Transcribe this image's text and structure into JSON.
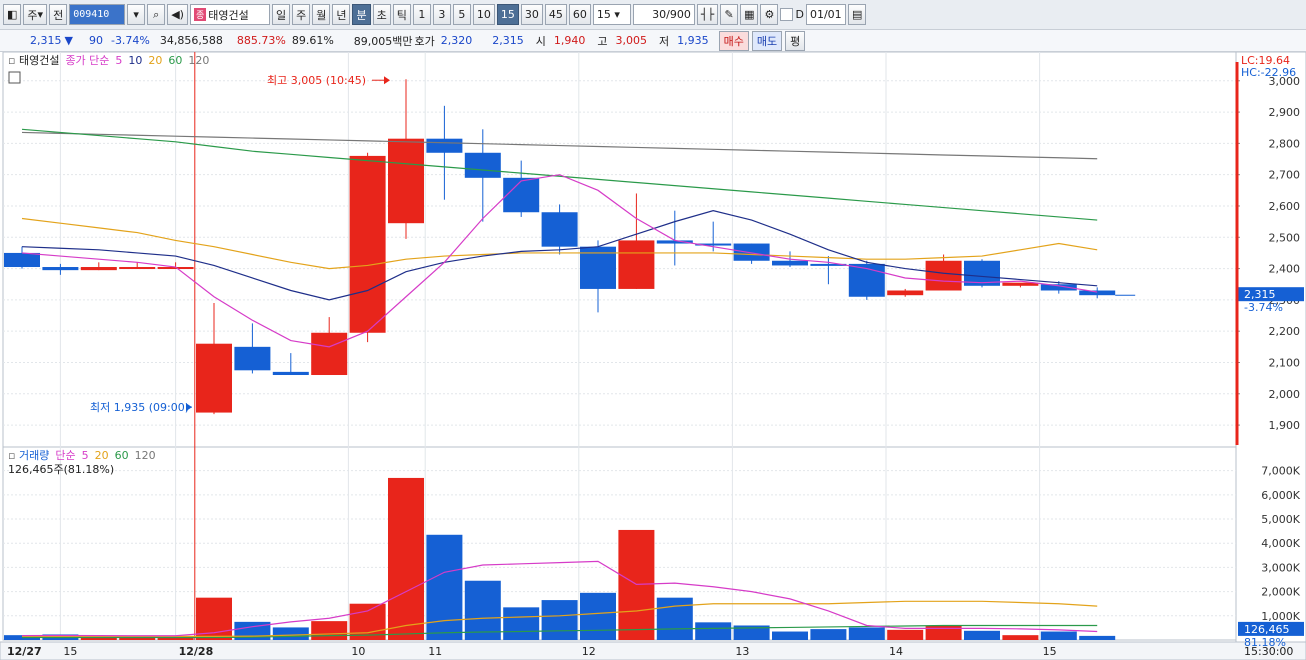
{
  "toolbar": {
    "type_label": "주",
    "prev_label": "전",
    "code": "009410",
    "stock_name": "태영건설",
    "stock_tag": "종",
    "periods": [
      "일",
      "주",
      "월",
      "년",
      "분",
      "초",
      "틱"
    ],
    "active_period": "분",
    "intervals": [
      "1",
      "3",
      "5",
      "10",
      "15",
      "30",
      "45",
      "60"
    ],
    "active_interval": "15",
    "interval_select": "15",
    "count_value": "30",
    "count_max": "/900",
    "date_value": "01/01",
    "checkbox_label": "D"
  },
  "quote": {
    "price": "2,315",
    "arrow": "▼",
    "change": "90",
    "change_pct": "-3.74%",
    "volume": "34,856,588",
    "volume_ratio": "885.73%",
    "turnover_ratio": "89.61%",
    "amount": "89,005백만",
    "ask_label": "호가",
    "ask": "2,320",
    "bid": "2,315",
    "open_label": "시",
    "open": "1,940",
    "high_label": "고",
    "high": "3,005",
    "low_label": "저",
    "low": "1,935",
    "buy_label": "매수",
    "sell_label": "매도",
    "avg_label": "평"
  },
  "colors": {
    "up": "#e8251b",
    "down": "#1560d4",
    "ma5": "#d63cc8",
    "ma10": "#1f2f8a",
    "ma20": "#e3a31b",
    "ma60": "#2b9a4a",
    "ma120": "#777777"
  },
  "chart_data": [
    {
      "type": "candlestick",
      "title": "태영건설",
      "legend_label": "종가 단순",
      "ma_labels": [
        "5",
        "10",
        "20",
        "60",
        "120"
      ],
      "info_lc": "LC:19.64",
      "info_hc": "HC:-22.96",
      "annotation_high": "최고 3,005 (10:45)",
      "annotation_low": "최저 1,935 (09:00)",
      "last_price_label": "2,315",
      "last_change_label": "-3.74%",
      "ylim": [
        1830,
        3060
      ],
      "yticks": [
        "1,900",
        "2,000",
        "2,100",
        "2,200",
        "2,300",
        "2,400",
        "2,500",
        "2,600",
        "2,700",
        "2,800",
        "2,900",
        "3,000"
      ],
      "ytick_values": [
        1900,
        2000,
        2100,
        2200,
        2300,
        2400,
        2500,
        2600,
        2700,
        2800,
        2900,
        3000
      ],
      "candles": [
        {
          "o": 2450,
          "h": 2470,
          "c": 2405,
          "l": 2400
        },
        {
          "o": 2405,
          "h": 2415,
          "c": 2395,
          "l": 2380
        },
        {
          "o": 2395,
          "h": 2420,
          "c": 2405,
          "l": 2395
        },
        {
          "o": 2405,
          "h": 2420,
          "c": 2405,
          "l": 2400
        },
        {
          "o": 2405,
          "h": 2420,
          "c": 2405,
          "l": 2400
        },
        {
          "o": 1940,
          "h": 2290,
          "c": 2160,
          "l": 1935
        },
        {
          "o": 2150,
          "h": 2225,
          "c": 2075,
          "l": 2065
        },
        {
          "o": 2070,
          "h": 2130,
          "c": 2060,
          "l": 2060
        },
        {
          "o": 2060,
          "h": 2245,
          "c": 2195,
          "l": 2060
        },
        {
          "o": 2195,
          "h": 2770,
          "c": 2760,
          "l": 2165
        },
        {
          "o": 2545,
          "h": 3005,
          "c": 2815,
          "l": 2495
        },
        {
          "o": 2815,
          "h": 2920,
          "c": 2770,
          "l": 2620
        },
        {
          "o": 2770,
          "h": 2845,
          "c": 2690,
          "l": 2550
        },
        {
          "o": 2690,
          "h": 2745,
          "c": 2580,
          "l": 2565
        },
        {
          "o": 2580,
          "h": 2605,
          "c": 2470,
          "l": 2445
        },
        {
          "o": 2470,
          "h": 2490,
          "c": 2335,
          "l": 2260
        },
        {
          "o": 2335,
          "h": 2640,
          "c": 2490,
          "l": 2335
        },
        {
          "o": 2490,
          "h": 2585,
          "c": 2480,
          "l": 2410
        },
        {
          "o": 2480,
          "h": 2550,
          "c": 2475,
          "l": 2455
        },
        {
          "o": 2480,
          "h": 2480,
          "c": 2425,
          "l": 2415
        },
        {
          "o": 2425,
          "h": 2455,
          "c": 2410,
          "l": 2405
        },
        {
          "o": 2415,
          "h": 2440,
          "c": 2410,
          "l": 2350
        },
        {
          "o": 2415,
          "h": 2425,
          "c": 2310,
          "l": 2300
        },
        {
          "o": 2315,
          "h": 2335,
          "c": 2330,
          "l": 2310
        },
        {
          "o": 2330,
          "h": 2445,
          "c": 2425,
          "l": 2330
        },
        {
          "o": 2425,
          "h": 2430,
          "c": 2345,
          "l": 2340
        },
        {
          "o": 2345,
          "h": 2350,
          "c": 2355,
          "l": 2340
        },
        {
          "o": 2350,
          "h": 2360,
          "c": 2330,
          "l": 2320
        },
        {
          "o": 2330,
          "h": 2340,
          "c": 2315,
          "l": 2305
        }
      ],
      "ma5": [
        2450,
        2440,
        2430,
        2420,
        2405,
        2310,
        2235,
        2170,
        2150,
        2200,
        2310,
        2420,
        2560,
        2680,
        2700,
        2650,
        2560,
        2490,
        2470,
        2450,
        2430,
        2420,
        2400,
        2370,
        2360,
        2355,
        2360,
        2345,
        2325
      ],
      "ma10": [
        2470,
        2465,
        2460,
        2450,
        2440,
        2410,
        2370,
        2330,
        2300,
        2330,
        2390,
        2420,
        2440,
        2455,
        2460,
        2470,
        2510,
        2550,
        2585,
        2555,
        2510,
        2460,
        2420,
        2400,
        2385,
        2375,
        2365,
        2355,
        2345
      ],
      "ma20": [
        2560,
        2545,
        2530,
        2515,
        2490,
        2470,
        2445,
        2420,
        2400,
        2410,
        2430,
        2440,
        2445,
        2450,
        2450,
        2450,
        2450,
        2450,
        2450,
        2445,
        2440,
        2435,
        2430,
        2430,
        2435,
        2440,
        2460,
        2480,
        2460
      ],
      "ma60": [
        2845,
        2835,
        2825,
        2815,
        2805,
        2790,
        2775,
        2765,
        2755,
        2745,
        2735,
        2725,
        2715,
        2705,
        2695,
        2685,
        2675,
        2665,
        2655,
        2645,
        2635,
        2625,
        2615,
        2605,
        2595,
        2585,
        2575,
        2565,
        2555
      ],
      "ma120": [
        2835,
        2832,
        2829,
        2826,
        2823,
        2820,
        2817,
        2814,
        2811,
        2808,
        2805,
        2802,
        2799,
        2796,
        2793,
        2790,
        2787,
        2784,
        2781,
        2778,
        2775,
        2772,
        2769,
        2766,
        2763,
        2760,
        2757,
        2754,
        2751
      ]
    },
    {
      "type": "bar",
      "title": "거래량",
      "legend_label": "단순",
      "ma_labels": [
        "5",
        "20",
        "60",
        "120"
      ],
      "info": "126,465주(81.18%)",
      "last_value_label": "126,465",
      "last_pct_label": "81.18%",
      "ylim": [
        0,
        7400
      ],
      "yticks": [
        "1,000K",
        "2,000K",
        "3,000K",
        "4,000K",
        "5,000K",
        "6,000K",
        "7,000K"
      ],
      "ytick_values": [
        1000,
        2000,
        3000,
        4000,
        5000,
        6000,
        7000
      ],
      "values": [
        200,
        230,
        150,
        150,
        150,
        1750,
        750,
        520,
        780,
        1500,
        6700,
        4350,
        2450,
        1350,
        1650,
        1950,
        4550,
        1750,
        730,
        600,
        350,
        450,
        520,
        420,
        600,
        380,
        200,
        350,
        170
      ],
      "ma5": [
        180,
        185,
        180,
        175,
        175,
        300,
        550,
        750,
        900,
        1200,
        2000,
        2800,
        3100,
        3150,
        3200,
        3250,
        2300,
        2350,
        2200,
        2000,
        1700,
        1200,
        600,
        480,
        480,
        480,
        460,
        420,
        350
      ],
      "ma20": [
        150,
        150,
        150,
        150,
        150,
        150,
        160,
        200,
        250,
        300,
        600,
        800,
        900,
        950,
        1000,
        1100,
        1200,
        1400,
        1500,
        1500,
        1500,
        1500,
        1550,
        1600,
        1600,
        1600,
        1550,
        1500,
        1400
      ],
      "ma60": [
        100,
        100,
        100,
        100,
        100,
        100,
        120,
        150,
        180,
        200,
        250,
        300,
        330,
        350,
        380,
        400,
        430,
        460,
        480,
        500,
        520,
        540,
        560,
        580,
        600,
        600,
        600,
        600,
        600
      ]
    }
  ],
  "x_labels": [
    "12/27",
    "15",
    "12/28",
    "10",
    "11",
    "12",
    "13",
    "14",
    "15",
    "15:30:00"
  ],
  "x_label_candle": [
    -1,
    1.5,
    4.5,
    9,
    11,
    15,
    19,
    23,
    27,
    33
  ]
}
